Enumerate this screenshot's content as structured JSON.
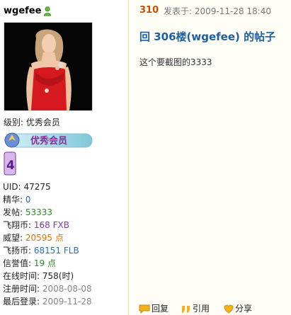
{
  "user": {
    "name": "wgefee",
    "level_label": "级别:",
    "level_value": "优秀会员",
    "rank_badge_text": "优秀会员",
    "rank_number": "4"
  },
  "stats": [
    {
      "label": "UID:",
      "value": "47275",
      "color": "#222222"
    },
    {
      "label": "精华:",
      "value": "0",
      "color": "#2d6cc0"
    },
    {
      "label": "发帖:",
      "value": "53333",
      "color": "#248b24"
    },
    {
      "label": "飞翔币:",
      "value": "168 FXB",
      "color": "#7a3aa8"
    },
    {
      "label": "威望:",
      "value": "20595 点",
      "color": "#e07000"
    },
    {
      "label": "飞扬币:",
      "value": "68151 FLB",
      "color": "#2d6cc0"
    },
    {
      "label": "信誉值:",
      "value": "19 点",
      "color": "#248b24"
    },
    {
      "label": "在线时间:",
      "value": "758(时)",
      "color": "#222222"
    },
    {
      "label": "注册时间:",
      "value": "2008-08-08",
      "color": "#888888"
    },
    {
      "label": "最后登录:",
      "value": "2009-11-28",
      "color": "#888888"
    }
  ],
  "post": {
    "floor": "310",
    "posted_label": "发表于:",
    "posted_time": "2009-11-28 18:40",
    "title": "回 306楼(wgefee) 的帖子",
    "body": "这个要截图的3333"
  },
  "actions": {
    "reply": "回复",
    "quote": "引用",
    "share": "分享"
  },
  "icons": {
    "online": "user-online-icon",
    "reply": "reply-icon",
    "quote": "quote-icon",
    "share": "heart-share-icon"
  },
  "colors": {
    "link_blue": "#1c5fa3",
    "floor_orange": "#c84b00",
    "post_bg": "#fefdf6"
  }
}
